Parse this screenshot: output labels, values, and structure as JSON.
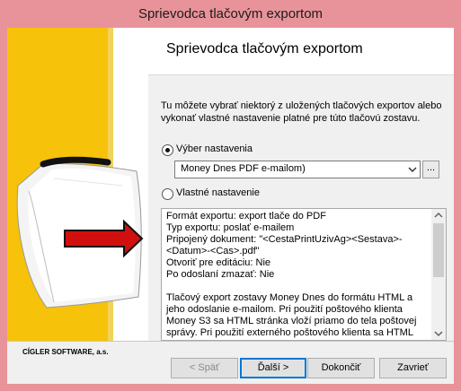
{
  "window": {
    "title": "Sprievodca tlačovým exportom"
  },
  "header": {
    "title": "Sprievodca tlačovým exportom"
  },
  "intro": "Tu môžete vybrať niektorý z uložených tlačových exportov alebo vykonať vlastné nastavenie platné pre túto tlačovú zostavu.",
  "options": {
    "preset_label": "Výber nastavenia",
    "custom_label": "Vlastné nastavenie",
    "selected": "preset"
  },
  "preset_select": {
    "value": "Money Dnes PDF e-mailom)",
    "more_label": "..."
  },
  "info": {
    "lines": [
      "Formát exportu: export tlače do PDF",
      "Typ exportu: poslať e-mailem",
      "Pripojený dokument:  \"<CestaPrintUzivAg><Sestava>-",
      "<Datum>-<Cas>.pdf\"",
      "Otvoriť pre editáciu: Nie",
      "Po odoslaní zmazať: Nie"
    ],
    "description": "Tlačový export zostavy Money Dnes do formátu HTML a jeho odoslanie e-mailom. Pri použití poštového klienta Money S3 sa HTML stránka vloží priamo do tela poštovej správy. Pri použití externého poštového klienta sa HTML stránka pripojí ako"
  },
  "company": "CÍGLER SOFTWARE, a.s.",
  "buttons": {
    "back": "< Späť",
    "next": "Ďalší >",
    "finish": "Dokončiť",
    "close": "Zavrieť"
  },
  "colors": {
    "title_bar": "#e8939a",
    "art_yellow": "#f6c20a",
    "arrow_red": "#d0100f",
    "default_button_border": "#0078d7"
  },
  "icons": {
    "combo": "chevron-down-icon",
    "scroll_up": "scroll-up-icon",
    "scroll_down": "scroll-down-icon"
  }
}
